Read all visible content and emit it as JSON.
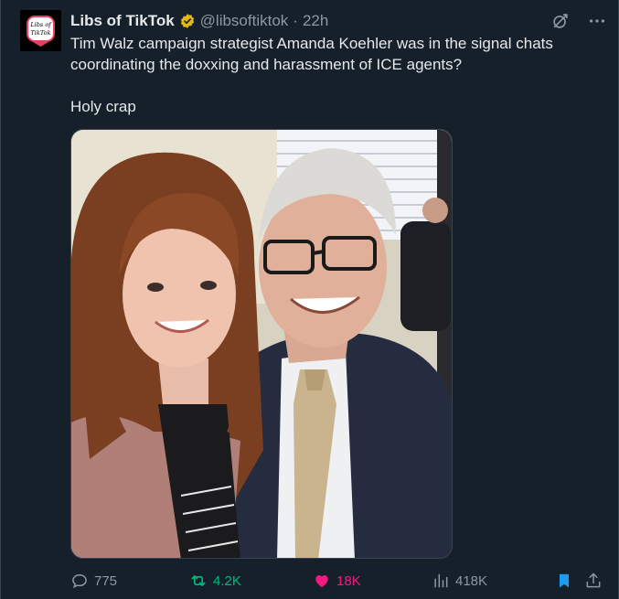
{
  "account": {
    "display_name": "Libs of TikTok",
    "handle": "@libsoftiktok",
    "separator": "·",
    "time": "22h",
    "avatar_text_line1": "Libs of",
    "avatar_text_line2": "TikTok"
  },
  "tweet": {
    "line1": "Tim Walz campaign strategist Amanda Koehler was in the signal chats",
    "line2": "coordinating the doxxing and harassment of ICE agents?",
    "line3": "Holy crap"
  },
  "metrics": {
    "replies": "775",
    "retweets": "4.2K",
    "likes": "18K",
    "views": "418K"
  },
  "icons": [
    "verified-badge-icon",
    "grok-icon",
    "more-icon",
    "reply-icon",
    "retweet-icon",
    "like-icon",
    "views-icon",
    "bookmark-icon",
    "share-icon"
  ],
  "colors": {
    "background": "#15202b",
    "retweet_active": "#00ba7c",
    "like_active": "#f91880",
    "bookmark_active": "#1d9bf0",
    "secondary_text": "#8b98a5"
  }
}
